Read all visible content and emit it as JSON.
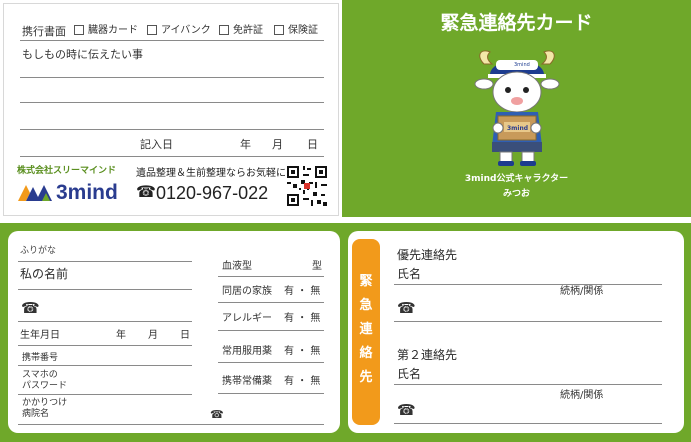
{
  "top_left": {
    "carry_doc_label": "携行書面",
    "checkboxes": [
      "臓器カード",
      "アイバンク",
      "免許証",
      "保険証"
    ],
    "message_label": "もしもの時に伝えたい事",
    "date_label": "記入日",
    "year": "年",
    "month": "月",
    "day": "日",
    "company_name": "株式会社スリーマインド",
    "logo_text": "3mind",
    "service_text": "遺品整理＆生前整理ならお気軽に",
    "free_dial_symbol": "☎",
    "phone_number": "0120-967-022"
  },
  "top_right": {
    "title": "緊急連絡先カード",
    "mascot_cap_text": "3mind",
    "mascot_box_text": "3mind",
    "character_caption": "3mind公式キャラクター",
    "character_name": "みつお"
  },
  "bottom_left": {
    "furigana_label": "ふりがな",
    "name_label": "私の名前",
    "phone_symbol": "☎",
    "birthday_label": "生年月日",
    "year": "年",
    "month": "月",
    "day": "日",
    "mobile_label": "携帯番号",
    "smartphone_pw_label_1": "スマホの",
    "smartphone_pw_label_2": "パスワード",
    "clinic_label_1": "かかりつけ",
    "clinic_label_2": "病院名",
    "clinic_phone_symbol": "☎",
    "blood_type_label": "血液型",
    "blood_type_suffix": "型",
    "yes_no_rows": [
      {
        "label": "同居の家族",
        "options": "有 ・ 無"
      },
      {
        "label": "アレルギー",
        "options": "有 ・ 無"
      },
      {
        "label": "常用服用薬",
        "options": "有 ・ 無"
      },
      {
        "label": "携帯常備薬",
        "options": "有 ・ 無"
      }
    ]
  },
  "bottom_right": {
    "tab_chars": [
      "緊",
      "急",
      "連",
      "絡",
      "先"
    ],
    "priority_contact_label": "優先連絡先",
    "name_label_1": "氏名",
    "relation_label_1": "続柄/関係",
    "phone_symbol_1": "☎",
    "second_contact_label": "第２連絡先",
    "name_label_2": "氏名",
    "relation_label_2": "続柄/関係",
    "phone_symbol_2": "☎"
  },
  "colors": {
    "green": "#6fa82a",
    "orange": "#f29a1b",
    "logo_blue": "#2a3c8f"
  }
}
